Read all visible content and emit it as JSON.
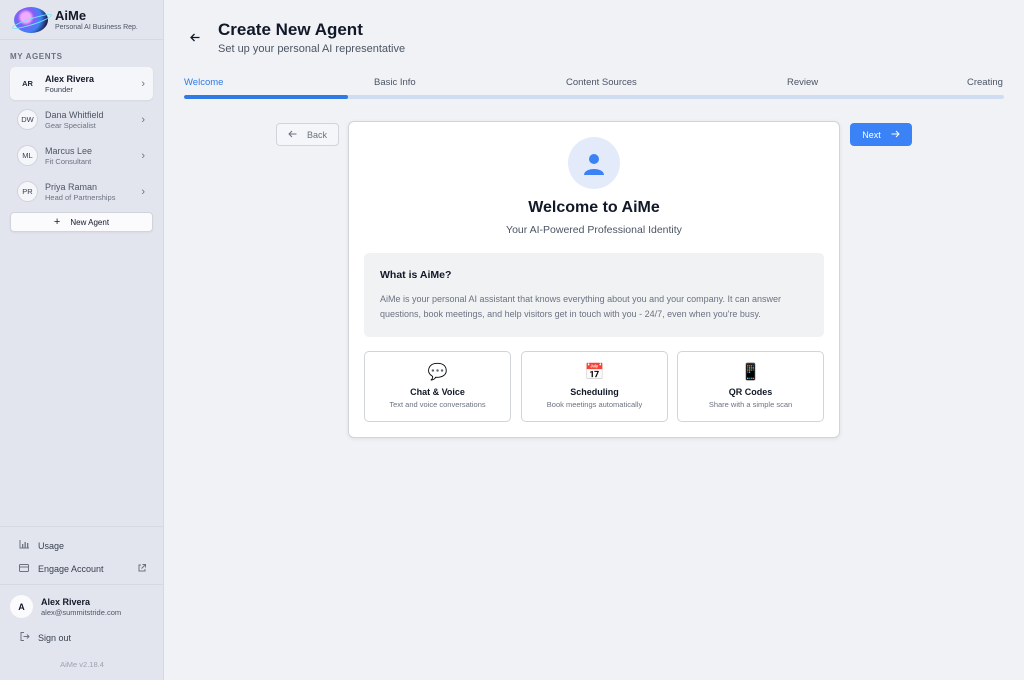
{
  "brand": {
    "name": "AiMe",
    "tagline": "Personal AI Business Rep."
  },
  "sidebar": {
    "section_label": "MY AGENTS",
    "agents": [
      {
        "initials": "AR",
        "name": "Alex Rivera",
        "role": "Founder",
        "active": true
      },
      {
        "initials": "DW",
        "name": "Dana Whitfield",
        "role": "Gear Specialist",
        "active": false
      },
      {
        "initials": "ML",
        "name": "Marcus Lee",
        "role": "Fit Consultant",
        "active": false
      },
      {
        "initials": "PR",
        "name": "Priya Raman",
        "role": "Head of Partnerships",
        "active": false
      }
    ],
    "new_agent_label": "New Agent",
    "links": [
      {
        "label": "Usage",
        "icon": "bar-chart-icon"
      },
      {
        "label": "Engage Account",
        "icon": "credit-card-icon",
        "trailing_icon": "external-link-icon"
      }
    ],
    "user": {
      "initial": "A",
      "name": "Alex Rivera",
      "email": "alex@summitstride.com"
    },
    "signout_label": "Sign out",
    "version": "AiMe v2.18.4"
  },
  "header": {
    "title": "Create New Agent",
    "subtitle": "Set up your personal AI representative"
  },
  "wizard": {
    "steps": [
      "Welcome",
      "Basic Info",
      "Content Sources",
      "Review",
      "Creating"
    ],
    "current_step": 0,
    "progress_fraction": 0.2,
    "back_label": "Back",
    "next_label": "Next"
  },
  "welcome": {
    "icon": "person-icon",
    "title": "Welcome to AiMe",
    "subtitle": "Your AI-Powered Professional Identity",
    "info_title": "What is AiMe?",
    "info_text": "AiMe is your personal AI assistant that knows everything about you and your company. It can answer questions, book meetings, and help visitors get in touch with you - 24/7, even when you're busy.",
    "features": [
      {
        "icon": "speech-bubble-icon",
        "glyph": "💬",
        "title": "Chat & Voice",
        "desc": "Text and voice conversations"
      },
      {
        "icon": "calendar-icon",
        "glyph": "📅",
        "title": "Scheduling",
        "desc": "Book meetings automatically"
      },
      {
        "icon": "phone-icon",
        "glyph": "📱",
        "title": "QR Codes",
        "desc": "Share with a simple scan"
      }
    ]
  },
  "colors": {
    "accent": "#3b82f6",
    "sidebar_bg": "#e3e5ee",
    "main_bg": "#f1f2f6"
  }
}
